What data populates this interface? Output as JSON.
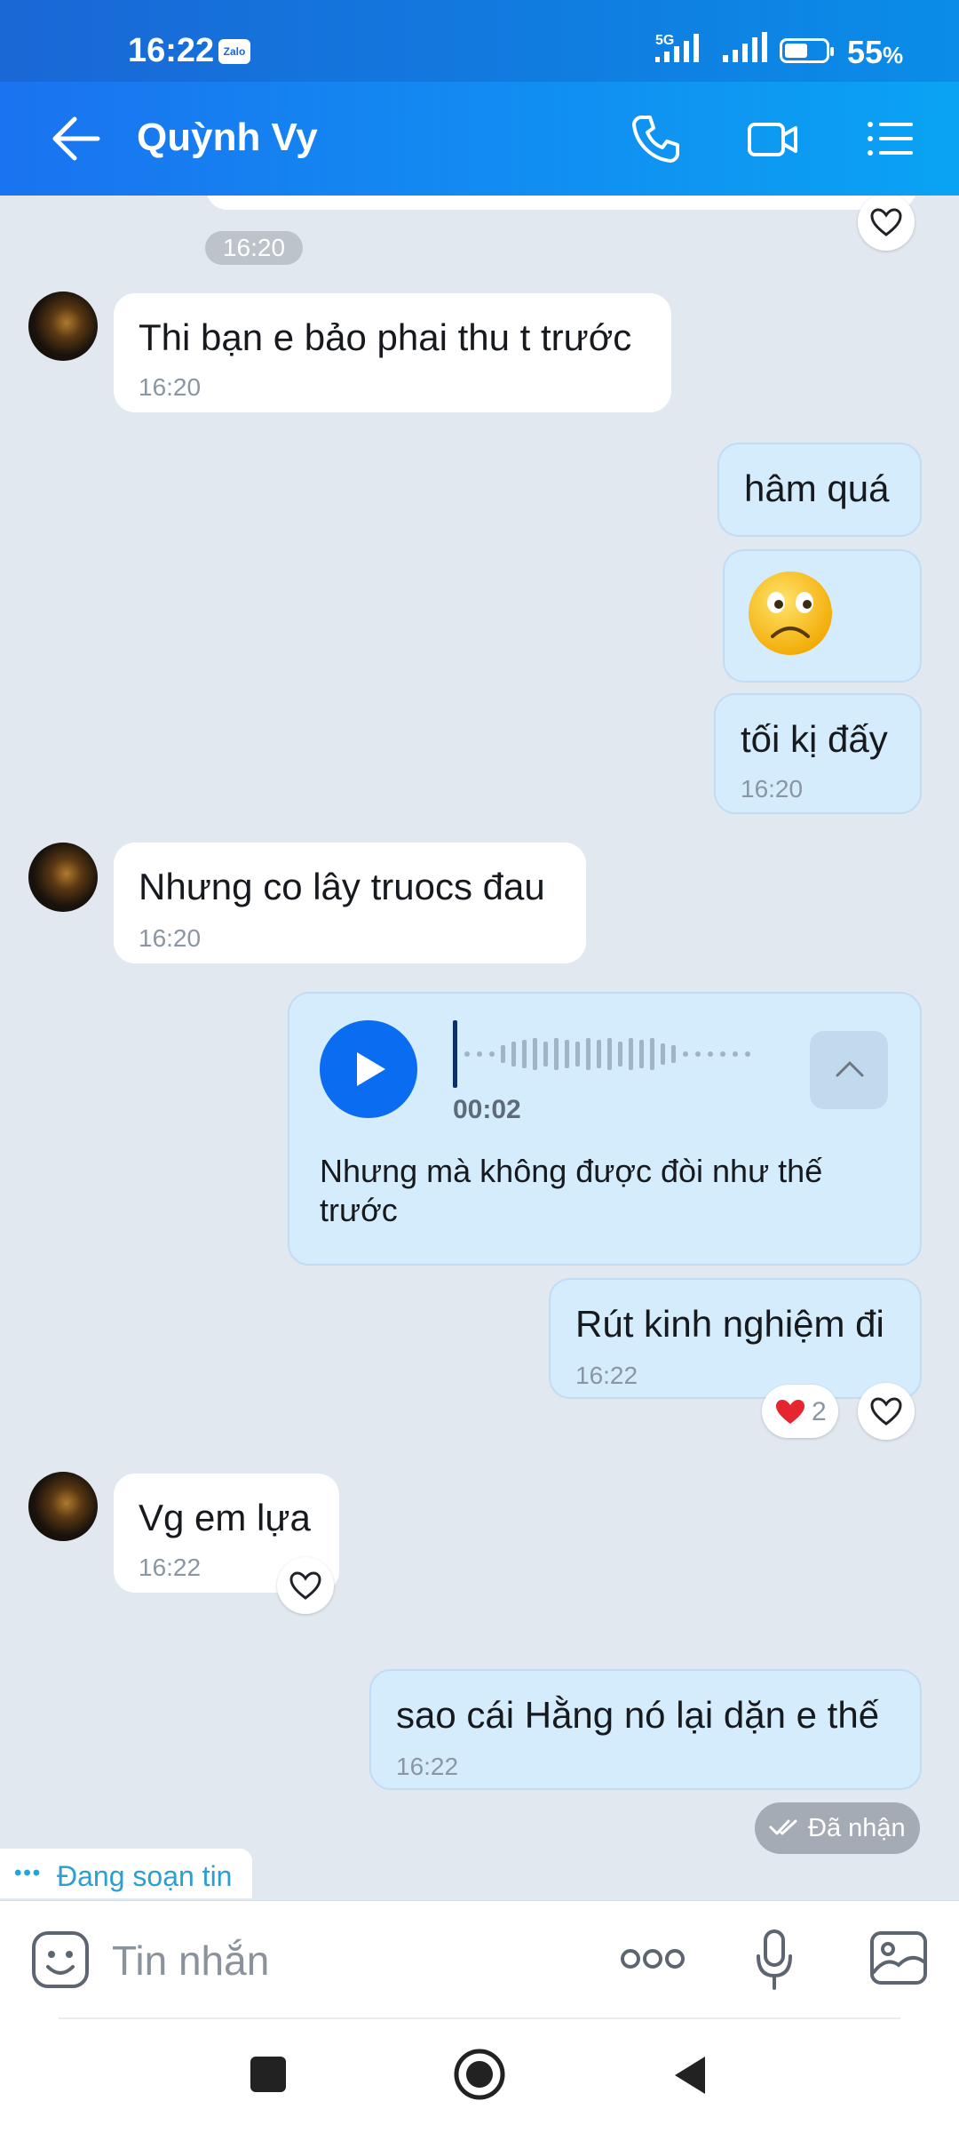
{
  "status_bar": {
    "time": "16:22",
    "app_badge": "Zalo",
    "network": "5G",
    "battery_pct": "55",
    "battery_unit": "%"
  },
  "header": {
    "contact_name": "Quỳnh Vy",
    "icons": [
      "back-arrow-icon",
      "phone-icon",
      "video-call-icon",
      "menu-list-icon"
    ]
  },
  "chat": {
    "time_separator": "16:20",
    "messages": [
      {
        "side": "in",
        "text": "Thi bạn e bảo phai thu t trước",
        "time": "16:20"
      },
      {
        "side": "out",
        "text": "hâm quá",
        "time": ""
      },
      {
        "side": "out",
        "type": "sticker",
        "sticker": "sad-face-emoji"
      },
      {
        "side": "out",
        "text": "tối kị đấy",
        "time": "16:20"
      },
      {
        "side": "in",
        "text": "Nhưng co lây truocs đau",
        "time": "16:20"
      },
      {
        "side": "out",
        "type": "voice",
        "duration": "00:02",
        "transcript": "Nhưng mà không được đòi như thế trước"
      },
      {
        "side": "out",
        "text": "Rút kinh nghiệm đi",
        "time": "16:22",
        "reaction_count": "2"
      },
      {
        "side": "in",
        "text": "Vg em lựa",
        "time": "16:22"
      },
      {
        "side": "out",
        "text": "sao cái Hằng nó lại dặn e thế",
        "time": "16:22"
      }
    ],
    "delivery_status": "Đã nhận",
    "typing_indicator": "Đang soạn tin"
  },
  "composer": {
    "placeholder": "Tin nhắn",
    "icons": [
      "sticker-icon",
      "more-icon",
      "microphone-icon",
      "image-icon"
    ]
  },
  "colors": {
    "header_blue": "#1a73f0",
    "outgoing_bubble": "#d5ecfd",
    "incoming_bubble": "#ffffff",
    "chat_bg": "#e2e8ef",
    "play_button": "#0a6cf0"
  }
}
